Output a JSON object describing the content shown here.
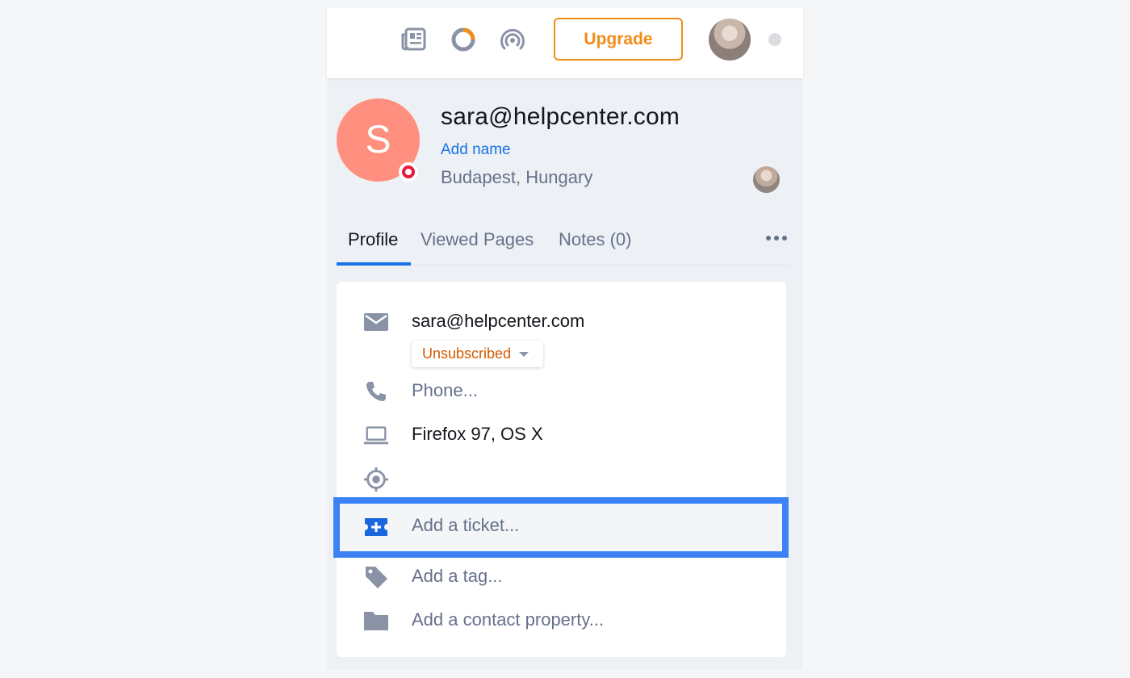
{
  "topbar": {
    "icons": [
      "newspaper-icon",
      "donut-chart-icon",
      "broadcast-icon"
    ],
    "upgrade_label": "Upgrade",
    "accent_color": "#f28c18"
  },
  "contact": {
    "avatar_initial": "S",
    "avatar_color": "#ff8f7e",
    "email": "sara@helpcenter.com",
    "add_name_label": "Add name",
    "location": "Budapest, Hungary"
  },
  "tabs": [
    {
      "label": "Profile",
      "active": true
    },
    {
      "label": "Viewed Pages",
      "active": false
    },
    {
      "label": "Notes (0)",
      "active": false
    }
  ],
  "details": {
    "email": "sara@helpcenter.com",
    "subscription_status": "Unsubscribed",
    "phone_placeholder": "Phone...",
    "browser": "Firefox 97, OS X",
    "location_value": "",
    "ticket_placeholder": "Add a ticket...",
    "tag_placeholder": "Add a tag...",
    "property_placeholder": "Add a contact property..."
  }
}
